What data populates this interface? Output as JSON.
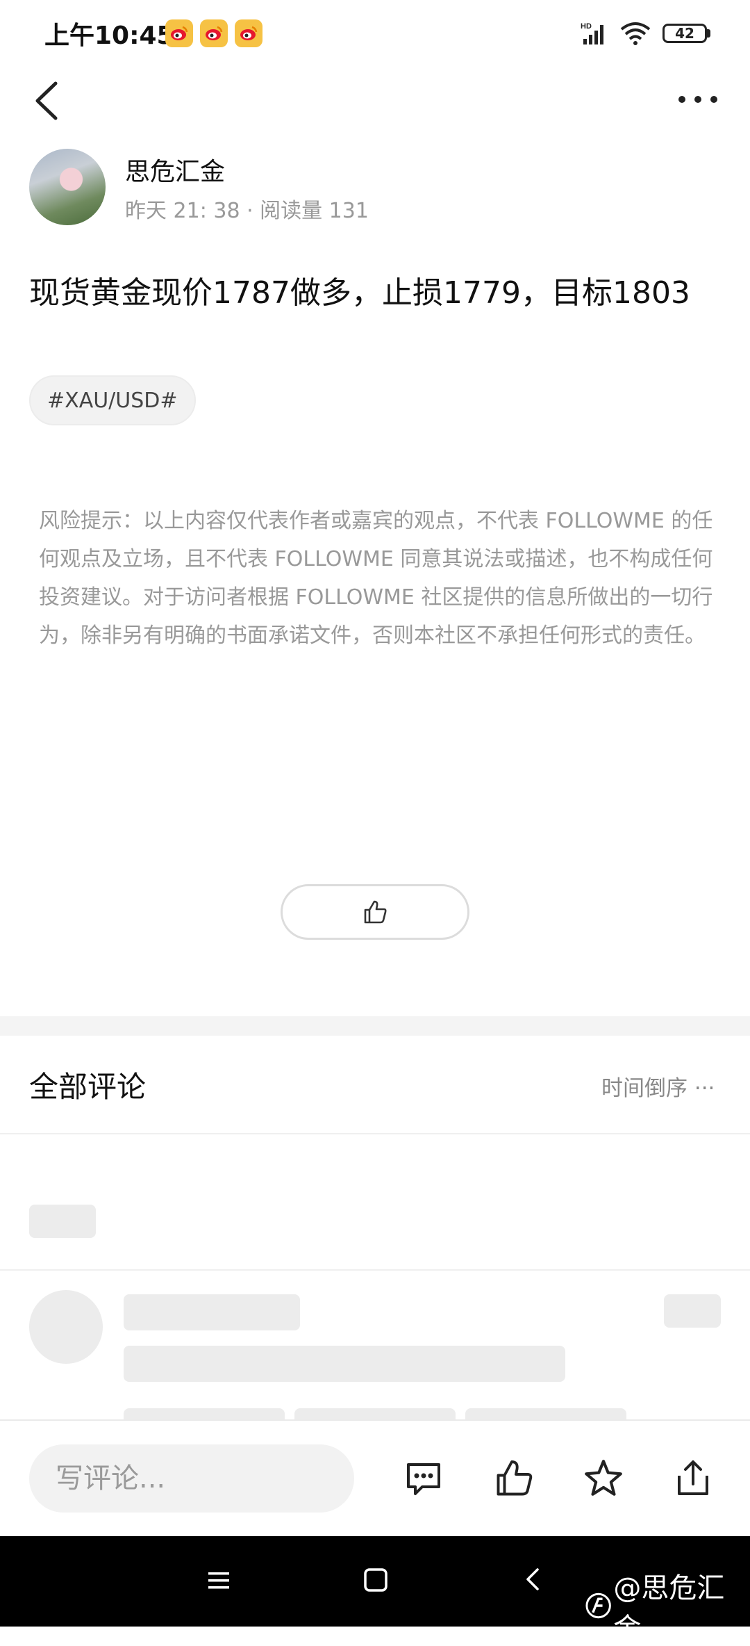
{
  "status_bar": {
    "time": "上午10:45",
    "signal_label": "HD",
    "battery": "42",
    "icons": [
      "weibo-icon",
      "weibo-icon",
      "weibo-icon",
      "signal-icon",
      "wifi-icon",
      "battery-icon"
    ]
  },
  "header": {
    "back_icon": "chevron-left-icon",
    "more_icon": "more-horizontal-icon"
  },
  "author": {
    "name": "思危汇金",
    "meta": "昨天 21: 38 · 阅读量 131"
  },
  "post": {
    "title": "现货黄金现价1787做多，止损1779，目标1803",
    "tag": "#XAU/USD#",
    "disclaimer": "风险提示：以上内容仅代表作者或嘉宾的观点，不代表 FOLLOWME 的任何观点及立场，且不代表 FOLLOWME 同意其说法或描述，也不构成任何投资建议。对于访问者根据 FOLLOWME 社区提供的信息所做出的一切行为，除非另有明确的书面承诺文件，否则本社区不承担任何形式的责任。"
  },
  "comments": {
    "title": "全部评论",
    "sort_label": "时间倒序 ···"
  },
  "bottom_bar": {
    "input_placeholder": "写评论...",
    "icons": [
      "comment-icon",
      "thumbs-up-icon",
      "star-icon",
      "share-icon"
    ]
  },
  "nav_bar": {
    "watermark": "@思危汇金"
  }
}
